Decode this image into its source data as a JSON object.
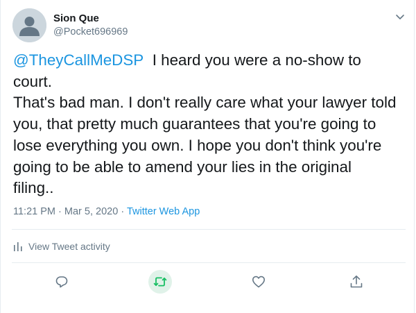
{
  "header": {
    "display_name": "Sion Que",
    "handle": "@Pocket696969"
  },
  "tweet": {
    "mention": "@TheyCallMeDSP",
    "line1_rest": "I heard you were a no-show to",
    "line2": "court.",
    "line3": "That's bad man. I don't really care what your lawyer told",
    "line4": "you, that pretty much guarantees that you're going to",
    "line5": "lose everything you own. I hope you don't think you're",
    "line6": "going to be able to amend your lies in the original",
    "line7": "filing.."
  },
  "meta": {
    "time": "11:21 PM",
    "separator1": "·",
    "date": "Mar 5, 2020",
    "separator2": "·",
    "source": "Twitter Web App"
  },
  "activity": {
    "label": "View Tweet activity"
  },
  "icons": {
    "caret": "chevron-down-icon",
    "activity": "bar-chart-icon",
    "reply": "reply-icon",
    "retweet": "retweet-icon",
    "like": "heart-icon",
    "share": "share-icon"
  },
  "colors": {
    "accent": "#1b95e0",
    "retweet_green": "#17bf63",
    "muted": "#657786",
    "text": "#14171a"
  }
}
